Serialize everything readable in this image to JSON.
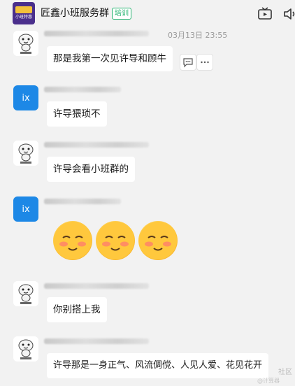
{
  "header": {
    "group_name": "匠鑫小班服务群",
    "badge": "培训",
    "group_avatar_text": "小班特惠",
    "icons": [
      "tv-icon",
      "speaker-icon"
    ]
  },
  "messages": [
    {
      "avatar_type": "sticker",
      "timestamp": "03月13日 23:55",
      "text": "那是我第一次见许导和顾牛",
      "actions": [
        "comment-icon",
        "more-icon"
      ]
    },
    {
      "avatar_type": "ix",
      "avatar_text": "ix",
      "text": "许导猥琐不"
    },
    {
      "avatar_type": "sticker",
      "text": "许导会看小班群的"
    },
    {
      "avatar_type": "ix",
      "avatar_text": "ix",
      "emoji_count": 3
    },
    {
      "avatar_type": "sticker",
      "text": "你别搭上我"
    },
    {
      "avatar_type": "sticker",
      "text": "许导那是一身正气、风流倜傥、人见人爱、花见花开"
    }
  ],
  "watermark": {
    "line1": "社区",
    "line2": "@计算器"
  },
  "colors": {
    "background": "#f2f2f2",
    "bubble": "#ffffff",
    "ix_avatar": "#1d88e6",
    "badge": "#22b26e"
  }
}
